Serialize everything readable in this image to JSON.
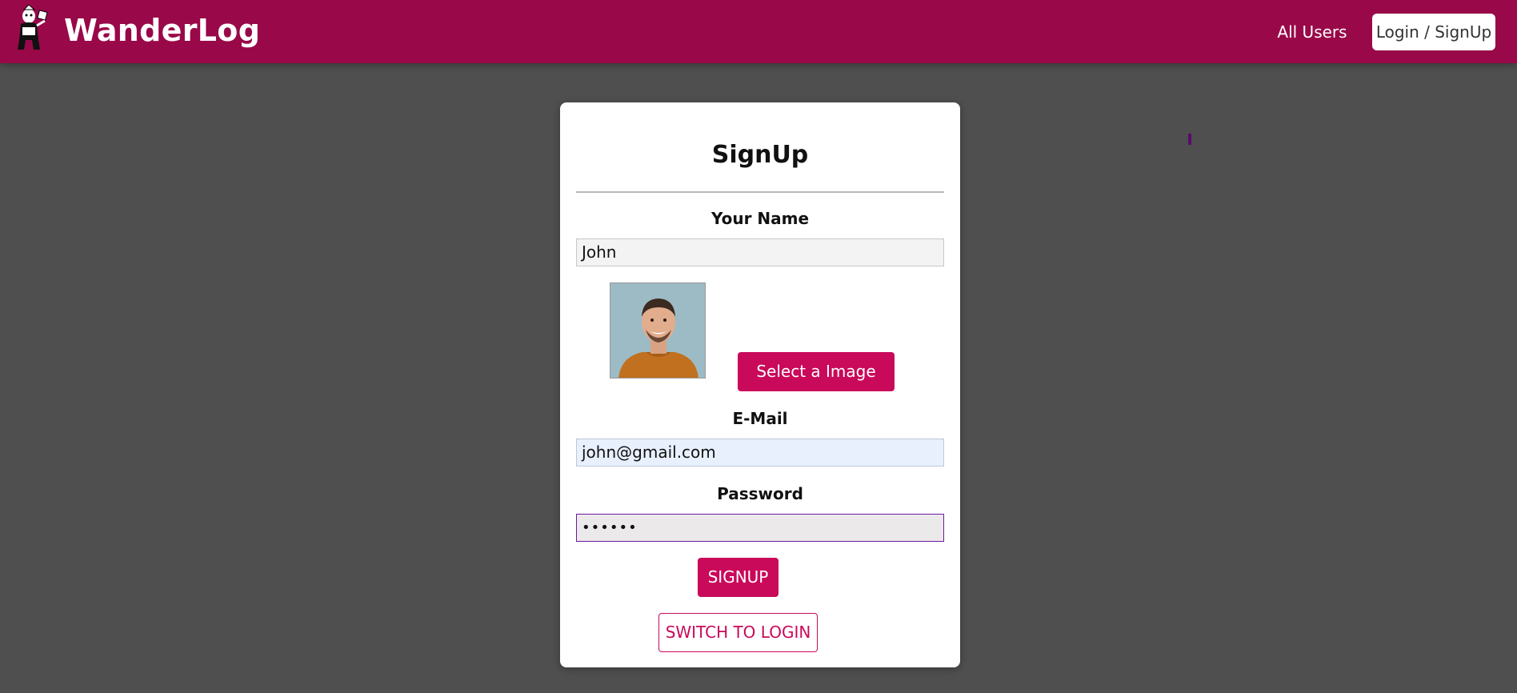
{
  "header": {
    "brand": "WanderLog",
    "logo_icon": "traveler-logo-icon",
    "nav": {
      "all_users": "All Users",
      "login_signup": "Login / SignUp"
    },
    "color": "#990848"
  },
  "form": {
    "title": "SignUp",
    "name_label": "Your Name",
    "name_value": "John",
    "image_button": "Select a Image",
    "email_label": "E-Mail",
    "email_value": "john@gmail.com",
    "password_label": "Password",
    "password_value": "••••••",
    "submit_button": "SIGNUP",
    "switch_button": "SWITCH TO LOGIN",
    "accent_color": "#c9095a"
  }
}
